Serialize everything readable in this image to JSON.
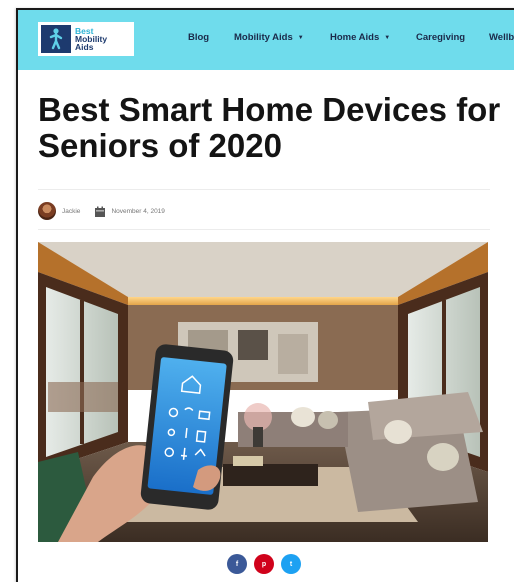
{
  "brand": {
    "logo_line1": "Best",
    "logo_line2": "Mobility",
    "logo_line3": "Aids"
  },
  "nav": {
    "items": [
      {
        "label": "Blog",
        "has_dropdown": false
      },
      {
        "label": "Mobility Aids",
        "has_dropdown": true
      },
      {
        "label": "Home Aids",
        "has_dropdown": true
      },
      {
        "label": "Caregiving",
        "has_dropdown": false
      },
      {
        "label": "Wellb",
        "has_dropdown": false
      }
    ],
    "dropdown_glyph": "▼"
  },
  "article": {
    "title": "Best Smart Home Devices for Seniors of 2020",
    "author": "Jackie",
    "date": "November 4, 2019",
    "hero_image": "smart-home-living-room-phone-photo"
  },
  "share": {
    "buttons": [
      {
        "network": "facebook",
        "glyph": "f",
        "color": "#3b5998"
      },
      {
        "network": "pinterest",
        "glyph": "p",
        "color": "#d0021b"
      },
      {
        "network": "twitter",
        "glyph": "t",
        "color": "#1da1f2"
      }
    ]
  },
  "colors": {
    "header_bg": "#6fdcec",
    "logo_blue": "#1d3a6e",
    "title_text": "#141414"
  }
}
